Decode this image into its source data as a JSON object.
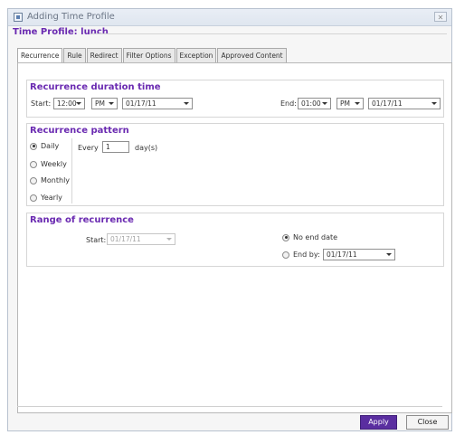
{
  "window": {
    "title": "Adding Time Profile",
    "close_glyph": "✕"
  },
  "profile": {
    "title": "Time Profile: lunch"
  },
  "tabs": [
    {
      "label": "Recurrence"
    },
    {
      "label": "Rule"
    },
    {
      "label": "Redirect"
    },
    {
      "label": "Filter Options"
    },
    {
      "label": "Exception"
    },
    {
      "label": "Approved Content"
    }
  ],
  "duration": {
    "title": "Recurrence duration time",
    "start_label": "Start:",
    "start_time": "12:00",
    "start_ampm": "PM",
    "start_date": "01/17/11",
    "end_label": "End:",
    "end_time": "01:00",
    "end_ampm": "PM",
    "end_date": "01/17/11"
  },
  "pattern": {
    "title": "Recurrence pattern",
    "options": [
      "Daily",
      "Weekly",
      "Monthly",
      "Yearly"
    ],
    "selected": "Daily",
    "every_label": "Every",
    "every_value": "1",
    "unit_label": "day(s)"
  },
  "range": {
    "title": "Range of recurrence",
    "start_label": "Start:",
    "start_date": "01/17/11",
    "no_end_label": "No end date",
    "end_by_label": "End by:",
    "end_by_date": "01/17/11",
    "selected": "No end date"
  },
  "buttons": {
    "apply": "Apply",
    "close": "Close"
  },
  "colors": {
    "accent": "#6a2ab1",
    "apply_button": "#5a2ea0"
  },
  "icons": {
    "app": "time-profile-icon",
    "close": "close-icon",
    "dropdown": "chevron-down-icon"
  }
}
